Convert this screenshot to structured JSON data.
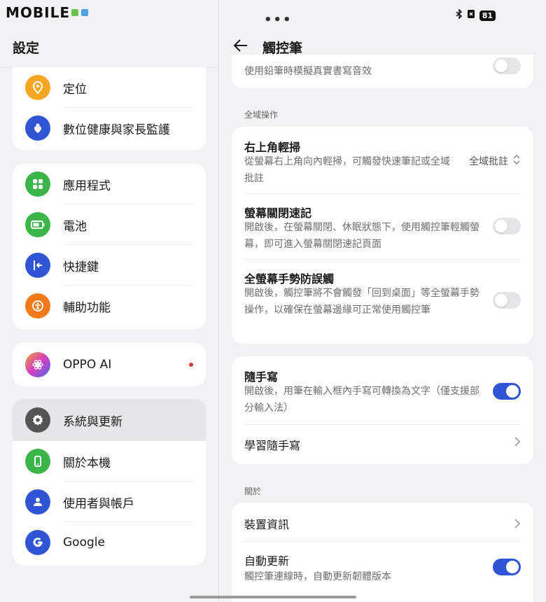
{
  "logo_text": "MOBILE01",
  "left": {
    "title": "設定",
    "groups": [
      [
        {
          "label": "定位",
          "icon": "location-icon",
          "color": "#f5a623"
        },
        {
          "label": "數位健康與家長監護",
          "icon": "wellbeing-icon",
          "color": "#2f55d4"
        }
      ],
      [
        {
          "label": "應用程式",
          "icon": "apps-icon",
          "color": "#3bb54a"
        },
        {
          "label": "電池",
          "icon": "battery-icon",
          "color": "#3bb54a"
        },
        {
          "label": "快捷鍵",
          "icon": "shortcut-icon",
          "color": "#2f55d4"
        },
        {
          "label": "輔助功能",
          "icon": "accessibility-icon",
          "color": "#f07a1a"
        }
      ],
      [
        {
          "label": "OPPO AI",
          "icon": "oppo-ai-icon",
          "color": "#c44bd6"
        }
      ],
      [
        {
          "label": "系統與更新",
          "icon": "gear-icon",
          "color": "#555555"
        },
        {
          "label": "關於本機",
          "icon": "phone-icon",
          "color": "#3bb54a"
        },
        {
          "label": "使用者與帳戶",
          "icon": "user-icon",
          "color": "#2f55d4"
        },
        {
          "label": "Google",
          "icon": "google-icon",
          "color": "#2f55d4"
        }
      ]
    ]
  },
  "status": {
    "battery": "81"
  },
  "right": {
    "title": "觸控筆",
    "top_partial_desc": "使用鉛筆時模擬真實書寫音效",
    "section_global": "全域操作",
    "swipe": {
      "title": "右上角輕掃",
      "desc": "從螢幕右上角向內輕掃，可觸發快速筆記或全域批註",
      "value": "全域批註"
    },
    "screen_off": {
      "title": "螢幕關閉速記",
      "desc": "開啟後，在螢幕關閉、休眠狀態下，使用觸控筆輕觸螢幕，即可進入螢幕關閉速記頁面",
      "enabled": false
    },
    "gesture": {
      "title": "全螢幕手勢防誤觸",
      "desc": "開啟後，觸控筆將不會觸發「回到桌面」等全螢幕手勢操作，以確保在螢幕邊緣可正常使用觸控筆",
      "enabled": false
    },
    "handwrite": {
      "title": "隨手寫",
      "desc": "開啟後，用筆在輸入框內手寫可轉換為文字（僅支援部分輸入法）",
      "enabled": true
    },
    "learn": {
      "title": "學習隨手寫"
    },
    "section_about": "關於",
    "device_info": {
      "title": "裝置資訊"
    },
    "auto_update": {
      "title": "自動更新",
      "desc": "觸控筆連線時，自動更新韌體版本",
      "enabled": true
    }
  },
  "colors": {
    "accent": "#2f55d4",
    "red_dot": "#d83a3a"
  }
}
